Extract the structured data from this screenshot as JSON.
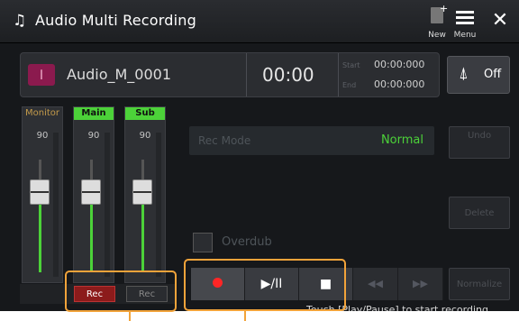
{
  "header": {
    "app_icon": "music-note-plus-icon",
    "title": "Audio Multi Recording",
    "new_label": "New",
    "menu_label": "Menu",
    "close_glyph": "✕"
  },
  "file": {
    "icon": "audio-wave-icon",
    "name": "Audio_M_0001",
    "time": "00:00",
    "start_label": "Start",
    "start_value": "00:00:000",
    "end_label": "End",
    "end_value": "00:00:000"
  },
  "metronome": {
    "icon": "metronome-icon",
    "label": "Off"
  },
  "mixer": {
    "strips": [
      {
        "label": "Monitor",
        "value": "90",
        "active": false
      },
      {
        "label": "Main",
        "value": "90",
        "active": true
      },
      {
        "label": "Sub",
        "value": "90",
        "active": true
      }
    ],
    "rec_buttons": [
      {
        "label": "Rec",
        "active": true
      },
      {
        "label": "Rec",
        "active": false
      }
    ]
  },
  "rec_mode": {
    "label": "Rec Mode",
    "value": "Normal"
  },
  "side_buttons": {
    "undo": "Undo",
    "delete": "Delete",
    "normalize": "Normalize"
  },
  "overdub": {
    "label": "Overdub",
    "checked": false
  },
  "transport": {
    "record_glyph": "●",
    "play_pause": "▶/II",
    "stop": "■",
    "rewind": "◀◀",
    "forward": "▶▶"
  },
  "status_text": "Touch [Play/Pause] to start recording.",
  "colors": {
    "accent_green": "#4cd239",
    "highlight_orange": "#f2a33a",
    "record_red": "#ff2626"
  }
}
